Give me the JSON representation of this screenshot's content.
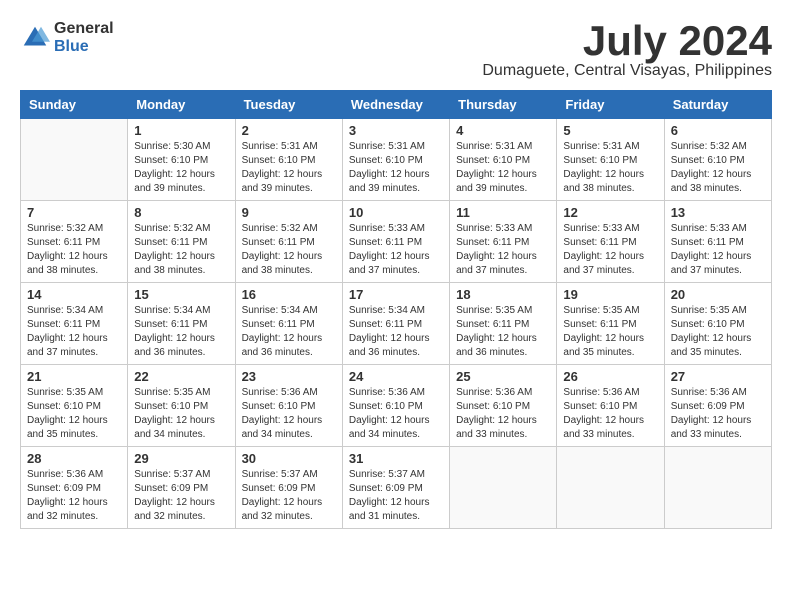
{
  "logo": {
    "general": "General",
    "blue": "Blue"
  },
  "title": {
    "month_year": "July 2024",
    "location": "Dumaguete, Central Visayas, Philippines"
  },
  "headers": [
    "Sunday",
    "Monday",
    "Tuesday",
    "Wednesday",
    "Thursday",
    "Friday",
    "Saturday"
  ],
  "weeks": [
    [
      {
        "day": "",
        "sunrise": "",
        "sunset": "",
        "daylight": ""
      },
      {
        "day": "1",
        "sunrise": "Sunrise: 5:30 AM",
        "sunset": "Sunset: 6:10 PM",
        "daylight": "Daylight: 12 hours and 39 minutes."
      },
      {
        "day": "2",
        "sunrise": "Sunrise: 5:31 AM",
        "sunset": "Sunset: 6:10 PM",
        "daylight": "Daylight: 12 hours and 39 minutes."
      },
      {
        "day": "3",
        "sunrise": "Sunrise: 5:31 AM",
        "sunset": "Sunset: 6:10 PM",
        "daylight": "Daylight: 12 hours and 39 minutes."
      },
      {
        "day": "4",
        "sunrise": "Sunrise: 5:31 AM",
        "sunset": "Sunset: 6:10 PM",
        "daylight": "Daylight: 12 hours and 39 minutes."
      },
      {
        "day": "5",
        "sunrise": "Sunrise: 5:31 AM",
        "sunset": "Sunset: 6:10 PM",
        "daylight": "Daylight: 12 hours and 38 minutes."
      },
      {
        "day": "6",
        "sunrise": "Sunrise: 5:32 AM",
        "sunset": "Sunset: 6:10 PM",
        "daylight": "Daylight: 12 hours and 38 minutes."
      }
    ],
    [
      {
        "day": "7",
        "sunrise": "Sunrise: 5:32 AM",
        "sunset": "Sunset: 6:11 PM",
        "daylight": "Daylight: 12 hours and 38 minutes."
      },
      {
        "day": "8",
        "sunrise": "Sunrise: 5:32 AM",
        "sunset": "Sunset: 6:11 PM",
        "daylight": "Daylight: 12 hours and 38 minutes."
      },
      {
        "day": "9",
        "sunrise": "Sunrise: 5:32 AM",
        "sunset": "Sunset: 6:11 PM",
        "daylight": "Daylight: 12 hours and 38 minutes."
      },
      {
        "day": "10",
        "sunrise": "Sunrise: 5:33 AM",
        "sunset": "Sunset: 6:11 PM",
        "daylight": "Daylight: 12 hours and 37 minutes."
      },
      {
        "day": "11",
        "sunrise": "Sunrise: 5:33 AM",
        "sunset": "Sunset: 6:11 PM",
        "daylight": "Daylight: 12 hours and 37 minutes."
      },
      {
        "day": "12",
        "sunrise": "Sunrise: 5:33 AM",
        "sunset": "Sunset: 6:11 PM",
        "daylight": "Daylight: 12 hours and 37 minutes."
      },
      {
        "day": "13",
        "sunrise": "Sunrise: 5:33 AM",
        "sunset": "Sunset: 6:11 PM",
        "daylight": "Daylight: 12 hours and 37 minutes."
      }
    ],
    [
      {
        "day": "14",
        "sunrise": "Sunrise: 5:34 AM",
        "sunset": "Sunset: 6:11 PM",
        "daylight": "Daylight: 12 hours and 37 minutes."
      },
      {
        "day": "15",
        "sunrise": "Sunrise: 5:34 AM",
        "sunset": "Sunset: 6:11 PM",
        "daylight": "Daylight: 12 hours and 36 minutes."
      },
      {
        "day": "16",
        "sunrise": "Sunrise: 5:34 AM",
        "sunset": "Sunset: 6:11 PM",
        "daylight": "Daylight: 12 hours and 36 minutes."
      },
      {
        "day": "17",
        "sunrise": "Sunrise: 5:34 AM",
        "sunset": "Sunset: 6:11 PM",
        "daylight": "Daylight: 12 hours and 36 minutes."
      },
      {
        "day": "18",
        "sunrise": "Sunrise: 5:35 AM",
        "sunset": "Sunset: 6:11 PM",
        "daylight": "Daylight: 12 hours and 36 minutes."
      },
      {
        "day": "19",
        "sunrise": "Sunrise: 5:35 AM",
        "sunset": "Sunset: 6:11 PM",
        "daylight": "Daylight: 12 hours and 35 minutes."
      },
      {
        "day": "20",
        "sunrise": "Sunrise: 5:35 AM",
        "sunset": "Sunset: 6:10 PM",
        "daylight": "Daylight: 12 hours and 35 minutes."
      }
    ],
    [
      {
        "day": "21",
        "sunrise": "Sunrise: 5:35 AM",
        "sunset": "Sunset: 6:10 PM",
        "daylight": "Daylight: 12 hours and 35 minutes."
      },
      {
        "day": "22",
        "sunrise": "Sunrise: 5:35 AM",
        "sunset": "Sunset: 6:10 PM",
        "daylight": "Daylight: 12 hours and 34 minutes."
      },
      {
        "day": "23",
        "sunrise": "Sunrise: 5:36 AM",
        "sunset": "Sunset: 6:10 PM",
        "daylight": "Daylight: 12 hours and 34 minutes."
      },
      {
        "day": "24",
        "sunrise": "Sunrise: 5:36 AM",
        "sunset": "Sunset: 6:10 PM",
        "daylight": "Daylight: 12 hours and 34 minutes."
      },
      {
        "day": "25",
        "sunrise": "Sunrise: 5:36 AM",
        "sunset": "Sunset: 6:10 PM",
        "daylight": "Daylight: 12 hours and 33 minutes."
      },
      {
        "day": "26",
        "sunrise": "Sunrise: 5:36 AM",
        "sunset": "Sunset: 6:10 PM",
        "daylight": "Daylight: 12 hours and 33 minutes."
      },
      {
        "day": "27",
        "sunrise": "Sunrise: 5:36 AM",
        "sunset": "Sunset: 6:09 PM",
        "daylight": "Daylight: 12 hours and 33 minutes."
      }
    ],
    [
      {
        "day": "28",
        "sunrise": "Sunrise: 5:36 AM",
        "sunset": "Sunset: 6:09 PM",
        "daylight": "Daylight: 12 hours and 32 minutes."
      },
      {
        "day": "29",
        "sunrise": "Sunrise: 5:37 AM",
        "sunset": "Sunset: 6:09 PM",
        "daylight": "Daylight: 12 hours and 32 minutes."
      },
      {
        "day": "30",
        "sunrise": "Sunrise: 5:37 AM",
        "sunset": "Sunset: 6:09 PM",
        "daylight": "Daylight: 12 hours and 32 minutes."
      },
      {
        "day": "31",
        "sunrise": "Sunrise: 5:37 AM",
        "sunset": "Sunset: 6:09 PM",
        "daylight": "Daylight: 12 hours and 31 minutes."
      },
      {
        "day": "",
        "sunrise": "",
        "sunset": "",
        "daylight": ""
      },
      {
        "day": "",
        "sunrise": "",
        "sunset": "",
        "daylight": ""
      },
      {
        "day": "",
        "sunrise": "",
        "sunset": "",
        "daylight": ""
      }
    ]
  ]
}
